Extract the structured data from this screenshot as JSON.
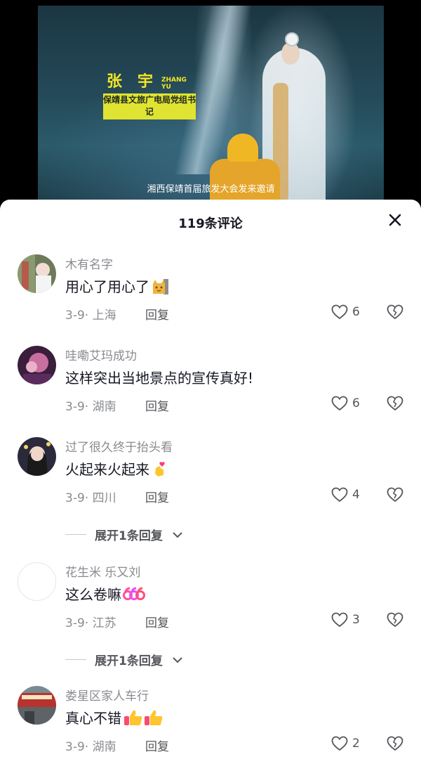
{
  "video": {
    "name_cn": "张宇",
    "name_en": "ZHANG YU",
    "role": "保靖县文旅广电局党组书 记",
    "subtitle": "湘西保靖首届旅发大会发来邀请"
  },
  "sheet": {
    "title": "119条评论"
  },
  "comments": [
    {
      "username": "木有名字",
      "text": "用心了用心了",
      "emoji": "cat-icon",
      "date_location": "3-9· 上海",
      "reply_label": "回复",
      "likes": "6"
    },
    {
      "username": "哇嘞艾玛成功",
      "text": "这样突出当地景点的宣传真好!",
      "emoji": "",
      "date_location": "3-9· 湖南",
      "reply_label": "回复",
      "likes": "6"
    },
    {
      "username": "过了很久终于抬头看",
      "text": "火起来火起来",
      "emoji": "finger-heart-icon",
      "date_location": "3-9· 四川",
      "reply_label": "回复",
      "likes": "4"
    },
    {
      "username": "花生米 乐又刘",
      "text": "这么卷嘛",
      "emoji": "666-icon",
      "date_location": "3-9· 江苏",
      "reply_label": "回复",
      "likes": "3"
    },
    {
      "username": "娄星区家人车行",
      "text": "真心不错",
      "emoji": "thumbs-up-icon",
      "date_location": "3-9· 湖南",
      "reply_label": "回复",
      "likes": "2"
    }
  ],
  "expand_replies": [
    {
      "label": "展开1条回复"
    },
    {
      "label": "展开1条回复"
    }
  ],
  "colors": {
    "accent_yellow": "#f4e623",
    "text_primary": "#161823",
    "text_secondary": "#8a8b91"
  }
}
